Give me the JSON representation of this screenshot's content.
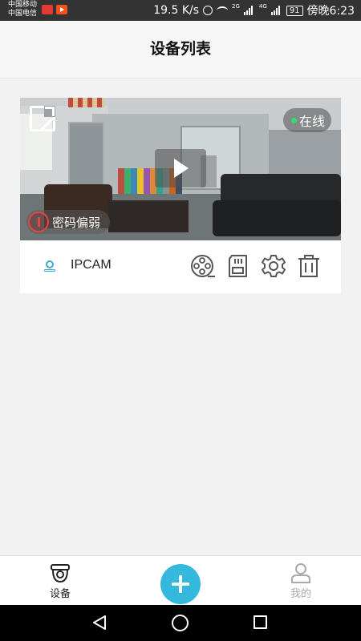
{
  "status_bar": {
    "carrier_1": "中国移动",
    "carrier_2": "中国电信",
    "net_speed": "19.5 K/s",
    "signal_1": "2G",
    "signal_2": "4G",
    "battery": "91",
    "time": "傍晚6:23"
  },
  "header": {
    "title": "设备列表"
  },
  "device": {
    "name": "IPCAM",
    "status": "在线",
    "warning": "密码偏弱",
    "status_color": "#2ee06a",
    "warning_color": "#e04646",
    "icon_color": "#3aa9d1"
  },
  "bottom_nav": {
    "devices_label": "设备",
    "mine_label": "我的",
    "add_color": "#35b8de"
  }
}
